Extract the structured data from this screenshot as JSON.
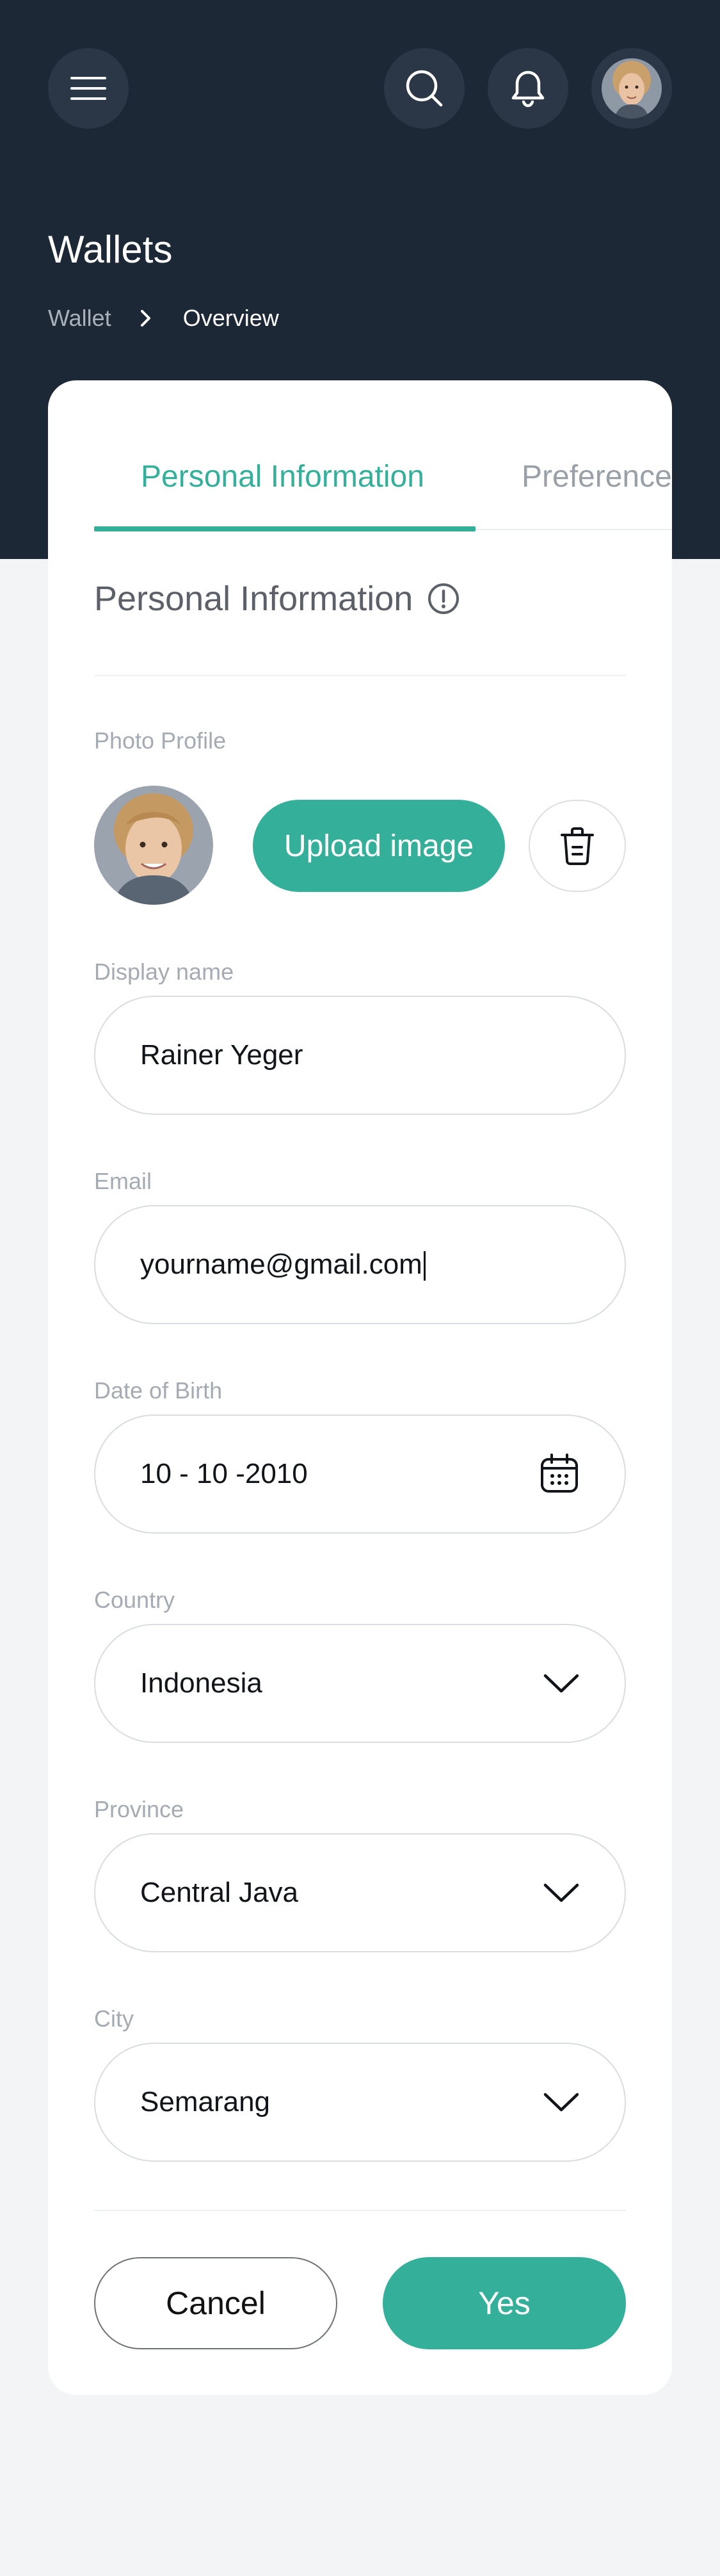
{
  "header": {
    "menu_icon": "hamburger-menu-icon",
    "search_icon": "search-icon",
    "notification_icon": "bell-icon",
    "avatar_icon": "user-avatar"
  },
  "page": {
    "title": "Wallets",
    "breadcrumb": [
      "Wallet",
      "Overview"
    ]
  },
  "tabs": [
    {
      "label": "Personal Information",
      "active": true
    },
    {
      "label": "Preference",
      "active": false
    }
  ],
  "section": {
    "title": "Personal Information",
    "info_icon": "info-circle-icon"
  },
  "photo": {
    "label": "Photo Profile",
    "upload_label": "Upload image",
    "delete_icon": "trash-icon"
  },
  "form": {
    "display_name": {
      "label": "Display name",
      "value": "Rainer Yeger"
    },
    "email": {
      "label": "Email",
      "value": "yourname@gmail.com"
    },
    "dob": {
      "label": "Date of Birth",
      "value": "10 - 10 -2010",
      "icon": "calendar-icon"
    },
    "country": {
      "label": "Country",
      "value": "Indonesia",
      "icon": "chevron-down-icon"
    },
    "province": {
      "label": "Province",
      "value": "Central Java",
      "icon": "chevron-down-icon"
    },
    "city": {
      "label": "City",
      "value": "Semarang",
      "icon": "chevron-down-icon"
    }
  },
  "actions": {
    "cancel_label": "Cancel",
    "confirm_label": "Yes"
  },
  "colors": {
    "accent": "#34b09a",
    "header_bg": "#1d2837",
    "page_bg": "#f3f4f6"
  }
}
